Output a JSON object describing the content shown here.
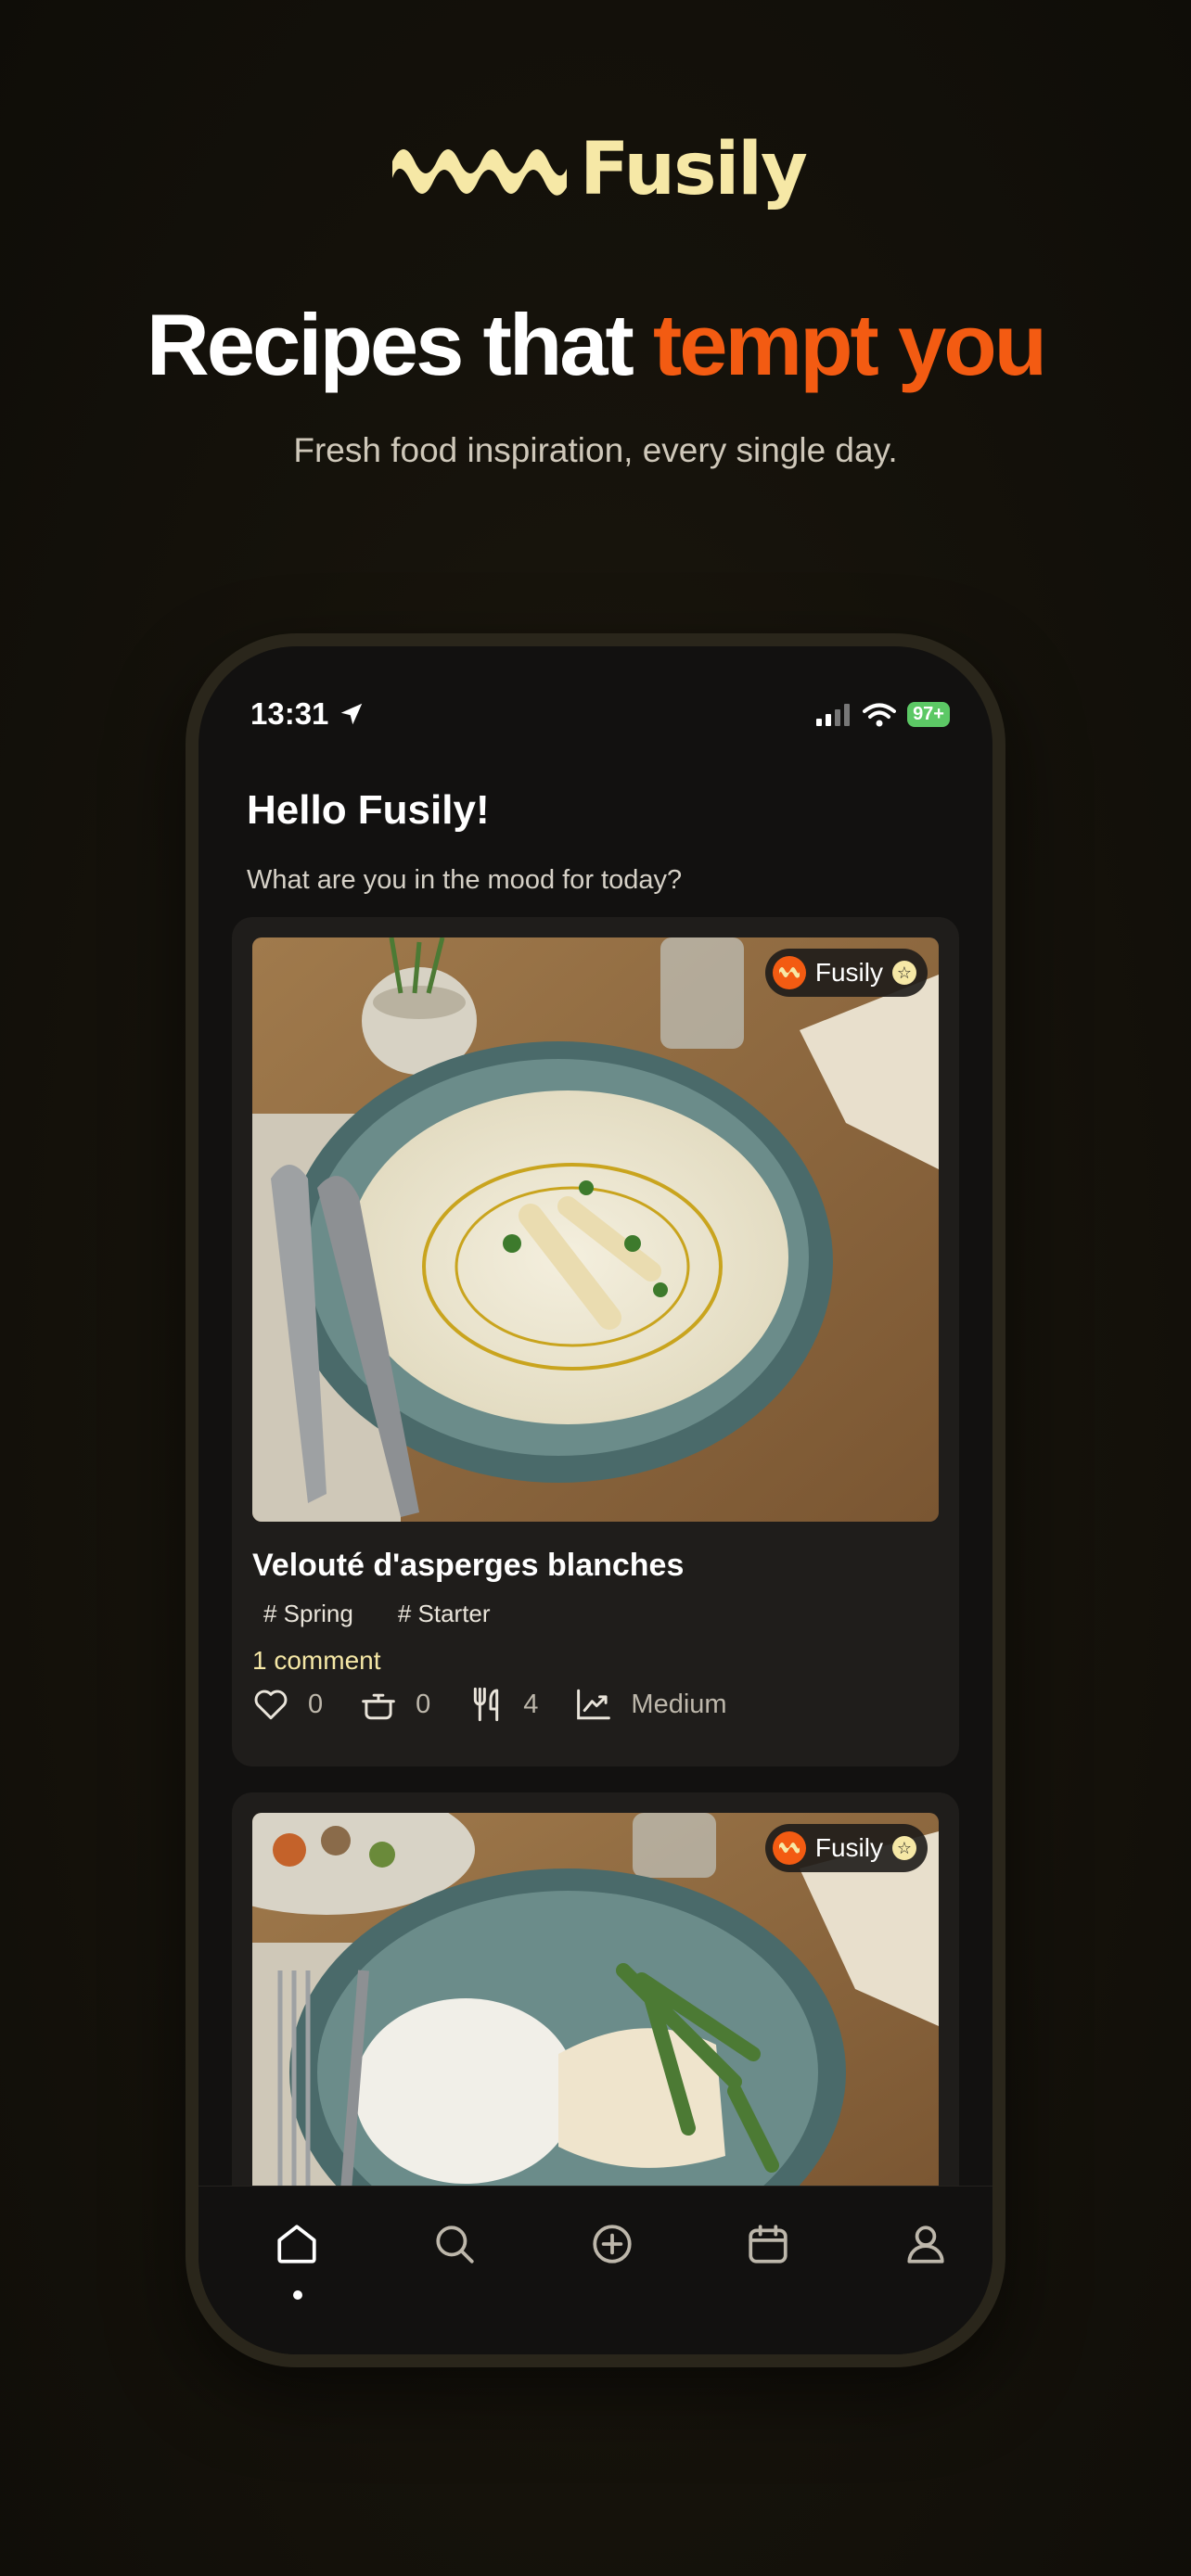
{
  "brand": {
    "name": "Fusily",
    "accent": "#f35b12",
    "logo_color": "#f6e8a6"
  },
  "hero": {
    "headline_part1": "Recipes that ",
    "headline_part2": "tempt you",
    "tagline": "Fresh food inspiration, every single day."
  },
  "status_bar": {
    "time": "13:31",
    "battery": "97+"
  },
  "greeting": {
    "title": "Hello Fusily!",
    "subtitle": "What are you in the mood for today?"
  },
  "recipes": [
    {
      "badge": "Fusily",
      "title": "Velouté d'asperges blanches",
      "tags": [
        "# Spring",
        "# Starter"
      ],
      "comments": "1 comment",
      "likes": "0",
      "cooked": "0",
      "servings": "4",
      "difficulty": "Medium"
    },
    {
      "badge": "Fusily"
    }
  ],
  "tabbar": {
    "items": [
      "home-icon",
      "search-icon",
      "add-icon",
      "calendar-icon",
      "profile-icon"
    ],
    "active": "home-icon"
  }
}
